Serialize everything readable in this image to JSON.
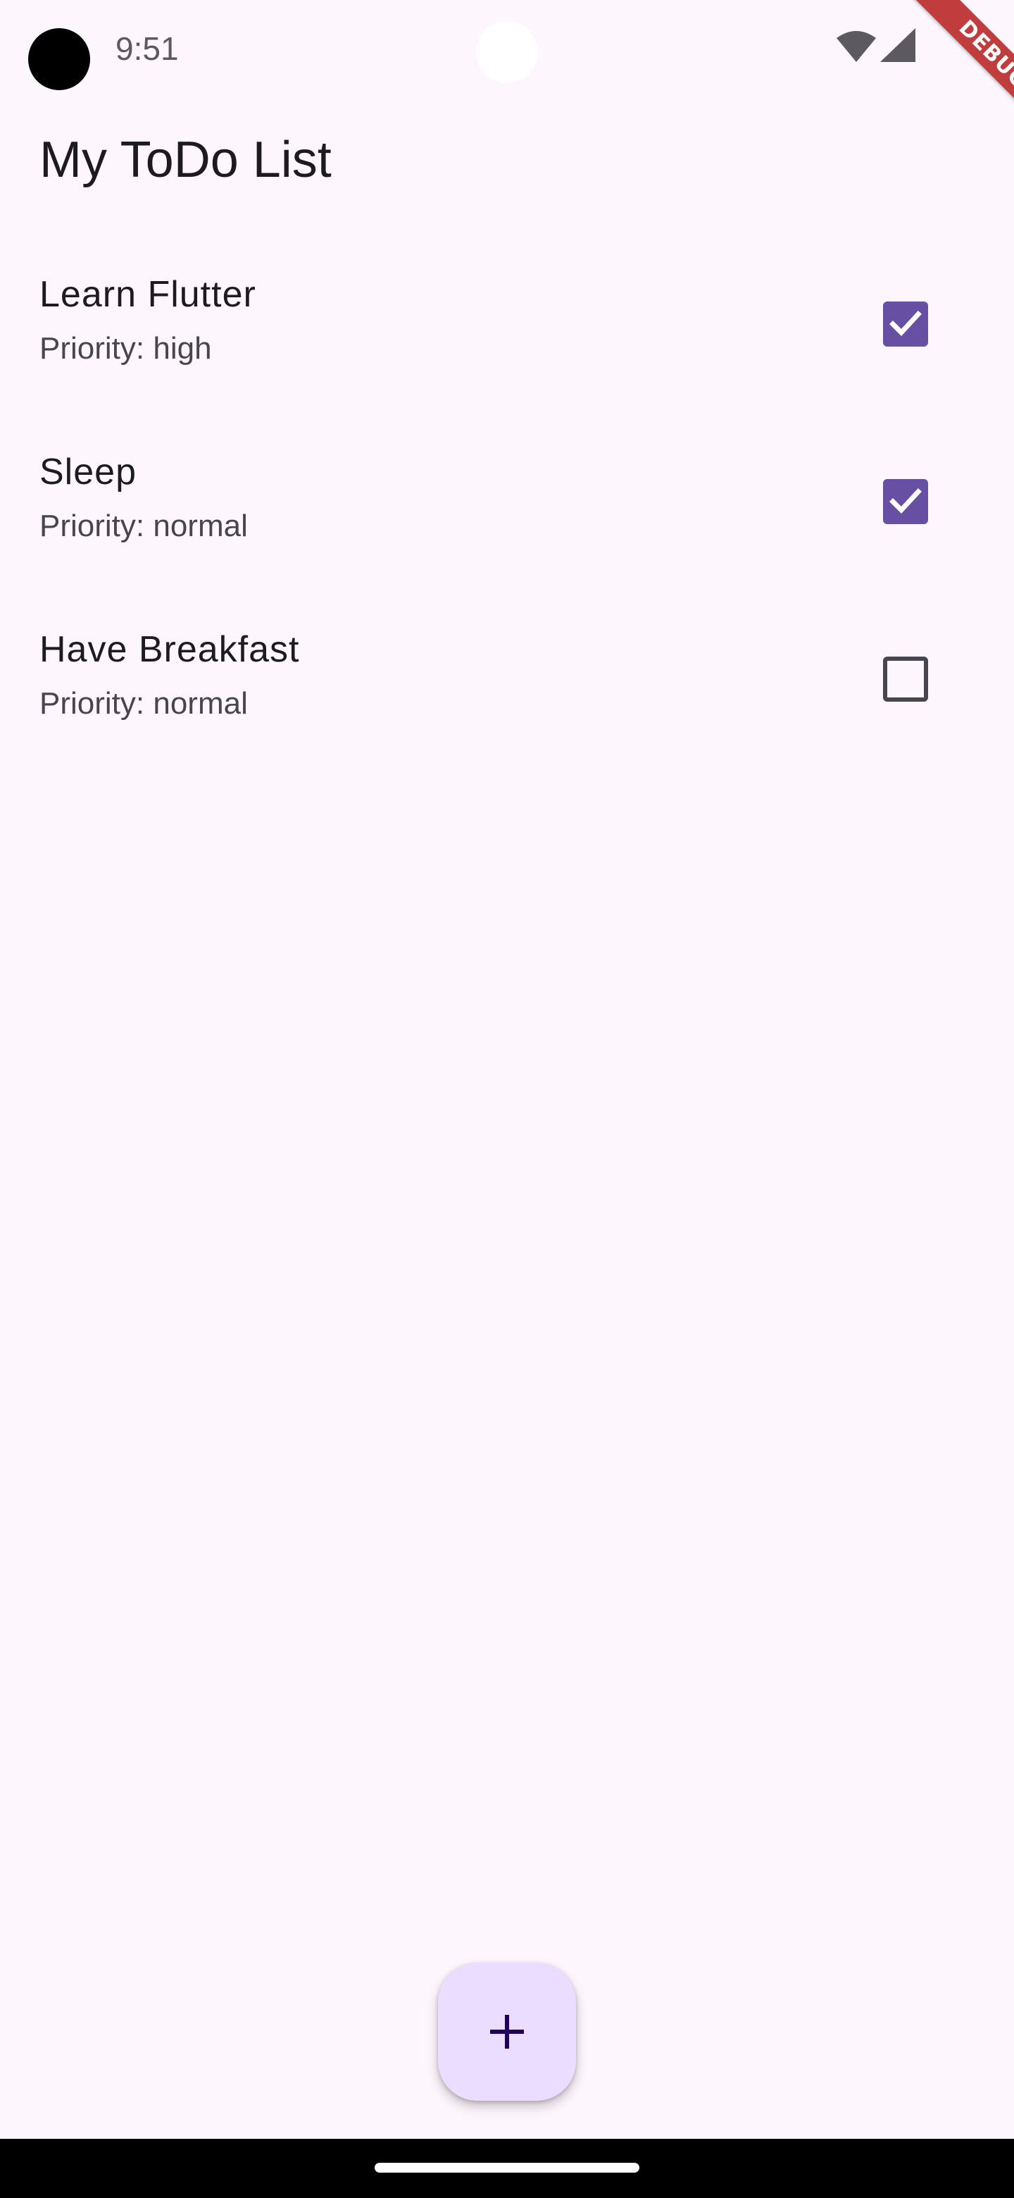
{
  "status_bar": {
    "time": "9:51",
    "icons": [
      "wifi-icon",
      "signal-icon"
    ]
  },
  "debug_banner": {
    "label": "DEBUG",
    "color": "#b71c1c"
  },
  "app": {
    "title": "My ToDo List"
  },
  "todos": [
    {
      "title": "Learn Flutter",
      "priority": "Priority: high",
      "done": true
    },
    {
      "title": "Sleep",
      "priority": "Priority: normal",
      "done": true
    },
    {
      "title": "Have Breakfast",
      "priority": "Priority: normal",
      "done": false
    }
  ],
  "fab": {
    "icon": "plus-icon",
    "background": "#eaddff"
  },
  "theme": {
    "accent": "#6750a4",
    "background": "#fdf7fd"
  }
}
